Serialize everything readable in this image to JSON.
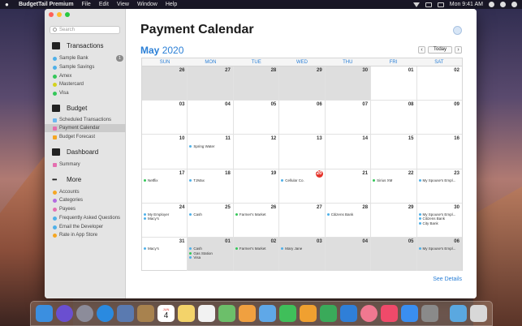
{
  "menubar": {
    "app_name": "BudgetTail Premium",
    "menus": [
      "File",
      "Edit",
      "View",
      "Window",
      "Help"
    ],
    "clock": "Mon 9:41 AM"
  },
  "sidebar": {
    "search_placeholder": "Search",
    "sections": {
      "transactions": "Transactions",
      "budget": "Budget",
      "dashboard": "Dashboard",
      "more": "More"
    },
    "accounts": [
      {
        "label": "Sample Bank",
        "color": "#4fb0e8"
      },
      {
        "label": "Sample Savings",
        "color": "#4fb0e8"
      },
      {
        "label": "Amex",
        "color": "#34c759"
      },
      {
        "label": "Mastercard",
        "color": "#d4d21e"
      },
      {
        "label": "Visa",
        "color": "#34c759"
      }
    ],
    "sample_bank_badge": "1",
    "budget_items": [
      {
        "label": "Scheduled Transactions",
        "color": "#6db8f0"
      },
      {
        "label": "Payment Calendar",
        "color": "#e56fb0"
      },
      {
        "label": "Budget Forecast",
        "color": "#f5a623"
      }
    ],
    "dashboard_items": [
      {
        "label": "Summary",
        "color": "#e56fb0"
      }
    ],
    "more_items": [
      {
        "label": "Accounts",
        "color": "#f5a623"
      },
      {
        "label": "Categories",
        "color": "#b36be0"
      },
      {
        "label": "Payees",
        "color": "#e56fb0"
      },
      {
        "label": "Frequently Asked Questions",
        "color": "#4fb0e8"
      },
      {
        "label": "Email the Developer",
        "color": "#4fb0e8"
      },
      {
        "label": "Rate in App Store",
        "color": "#f5a623"
      }
    ]
  },
  "main": {
    "title": "Payment Calendar",
    "month": "May",
    "year": "2020",
    "today_button": "Today",
    "prev_label": "‹",
    "next_label": "›",
    "see_details": "See Details",
    "weekdays": [
      "SUN",
      "MON",
      "TUE",
      "WED",
      "THU",
      "FRI",
      "SAT"
    ],
    "weeks": [
      [
        {
          "d": "26",
          "o": true
        },
        {
          "d": "27",
          "o": true
        },
        {
          "d": "28",
          "o": true
        },
        {
          "d": "29",
          "o": true
        },
        {
          "d": "30",
          "o": true
        },
        {
          "d": "01"
        },
        {
          "d": "02"
        }
      ],
      [
        {
          "d": "03"
        },
        {
          "d": "04"
        },
        {
          "d": "05"
        },
        {
          "d": "06"
        },
        {
          "d": "07"
        },
        {
          "d": "08"
        },
        {
          "d": "09"
        }
      ],
      [
        {
          "d": "10"
        },
        {
          "d": "11",
          "ev": [
            [
              "Spring Water",
              "#4fb0e8"
            ]
          ]
        },
        {
          "d": "12"
        },
        {
          "d": "13"
        },
        {
          "d": "14"
        },
        {
          "d": "15"
        },
        {
          "d": "16"
        }
      ],
      [
        {
          "d": "17",
          "ev": [
            [
              "Netflix",
              "#34c759"
            ]
          ]
        },
        {
          "d": "18",
          "ev": [
            [
              "TJMax",
              "#4fb0e8"
            ]
          ]
        },
        {
          "d": "19"
        },
        {
          "d": "20",
          "today": true,
          "ev": [
            [
              "Cellular Co.",
              "#4fb0e8"
            ]
          ]
        },
        {
          "d": "21"
        },
        {
          "d": "22",
          "ev": [
            [
              "Sirius XM",
              "#34c759"
            ]
          ]
        },
        {
          "d": "23",
          "ev": [
            [
              "My Spouse's Empl...",
              "#4fb0e8"
            ]
          ]
        }
      ],
      [
        {
          "d": "24",
          "ev": [
            [
              "My Employer",
              "#4fb0e8"
            ],
            [
              "Macy's",
              "#4fb0e8"
            ]
          ]
        },
        {
          "d": "25",
          "ev": [
            [
              "Cash",
              "#4fb0e8"
            ]
          ]
        },
        {
          "d": "26",
          "ev": [
            [
              "Farmer's Market",
              "#34c759"
            ]
          ]
        },
        {
          "d": "27"
        },
        {
          "d": "28",
          "ev": [
            [
              "Citizens Bank",
              "#4fb0e8"
            ]
          ]
        },
        {
          "d": "29"
        },
        {
          "d": "30",
          "ev": [
            [
              "My Spouse's Empl...",
              "#4fb0e8"
            ],
            [
              "Citizens Bank",
              "#4fb0e8"
            ],
            [
              "City Bank",
              "#4fb0e8"
            ]
          ]
        }
      ],
      [
        {
          "d": "31",
          "ev": [
            [
              "Macy's",
              "#4fb0e8"
            ]
          ]
        },
        {
          "d": "01",
          "o": true,
          "ev": [
            [
              "Cash",
              "#4fb0e8"
            ],
            [
              "Gas Station",
              "#34c759"
            ],
            [
              "Visa",
              "#4fb0e8"
            ]
          ]
        },
        {
          "d": "02",
          "o": true,
          "ev": [
            [
              "Farmer's Market",
              "#34c759"
            ]
          ]
        },
        {
          "d": "03",
          "o": true,
          "ev": [
            [
              "Mary Jane",
              "#4fb0e8"
            ]
          ]
        },
        {
          "d": "04",
          "o": true
        },
        {
          "d": "05",
          "o": true
        },
        {
          "d": "06",
          "o": true,
          "ev": [
            [
              "My Spouse's Empl...",
              "#4fb0e8"
            ]
          ]
        }
      ]
    ]
  },
  "dock": {
    "calendar_month": "JUN",
    "calendar_day": "4",
    "icons": [
      {
        "name": "finder-icon",
        "color": "#3b8fe0"
      },
      {
        "name": "siri-icon",
        "color": "#6a4fd0"
      },
      {
        "name": "launchpad-icon",
        "color": "#8c8c9a"
      },
      {
        "name": "safari-icon",
        "color": "#2a8ae0"
      },
      {
        "name": "preview-icon",
        "color": "#5a7ab0"
      },
      {
        "name": "notes-brown-icon",
        "color": "#a8824e"
      },
      {
        "name": "calendar-icon",
        "color": "#ffffff"
      },
      {
        "name": "notes-icon",
        "color": "#f3d36a"
      },
      {
        "name": "reminders-icon",
        "color": "#f2f2f2"
      },
      {
        "name": "maps-icon",
        "color": "#6cbf6a"
      },
      {
        "name": "photos-icon",
        "color": "#f0a040"
      },
      {
        "name": "messages-icon",
        "color": "#5fa8e8"
      },
      {
        "name": "facetime-icon",
        "color": "#3fbf5a"
      },
      {
        "name": "pages-icon",
        "color": "#f0a030"
      },
      {
        "name": "numbers-icon",
        "color": "#3aaa5a"
      },
      {
        "name": "keynote-icon",
        "color": "#2f7fd8"
      },
      {
        "name": "budgettail-icon",
        "color": "#f07890"
      },
      {
        "name": "music-icon",
        "color": "#f04a6a"
      },
      {
        "name": "app-store-icon",
        "color": "#3a8ef0"
      },
      {
        "name": "system-preferences-icon",
        "color": "#8a8a8a"
      }
    ],
    "trailing": [
      {
        "name": "downloads-folder-icon",
        "color": "#5aa8e0"
      },
      {
        "name": "trash-icon",
        "color": "#d8d8d8"
      }
    ]
  }
}
